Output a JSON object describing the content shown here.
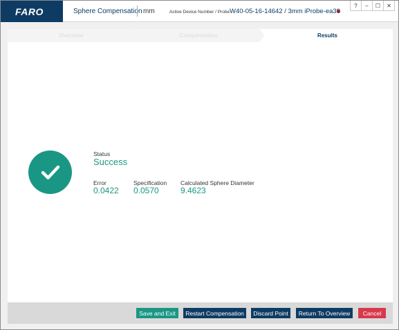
{
  "titlebar": {
    "logo": "FARO",
    "app_title": "Sphere Compensation",
    "units": "mm",
    "device_label": "Active Device Number / Probe",
    "device_value": "W40-05-16-14642 / 3mm iProbe-ea39",
    "buttons": {
      "help": "?",
      "minimize": "–",
      "maximize": "☐",
      "close": "✕"
    }
  },
  "steps": [
    {
      "label": "Overview",
      "state": "complete"
    },
    {
      "label": "Compensation",
      "state": "complete"
    },
    {
      "label": "Results",
      "state": "active"
    }
  ],
  "results": {
    "status_label": "Status",
    "status_value": "Success",
    "error_label": "Error",
    "error_value": "0.0422",
    "spec_label": "Specification",
    "spec_value": "0.0570",
    "diameter_label": "Calculated Sphere Diameter",
    "diameter_value": "9.4623"
  },
  "footer": {
    "save_exit": "Save and Exit",
    "restart": "Restart Compensation",
    "discard": "Discard Point",
    "return_overview": "Return To Overview",
    "cancel": "Cancel"
  },
  "icons": {
    "success": "check-circle-icon"
  },
  "colors": {
    "brand_navy": "#0e3b63",
    "success_teal": "#1a9784",
    "cancel_red": "#d8394b",
    "device_status_dot": "#8a2338"
  }
}
